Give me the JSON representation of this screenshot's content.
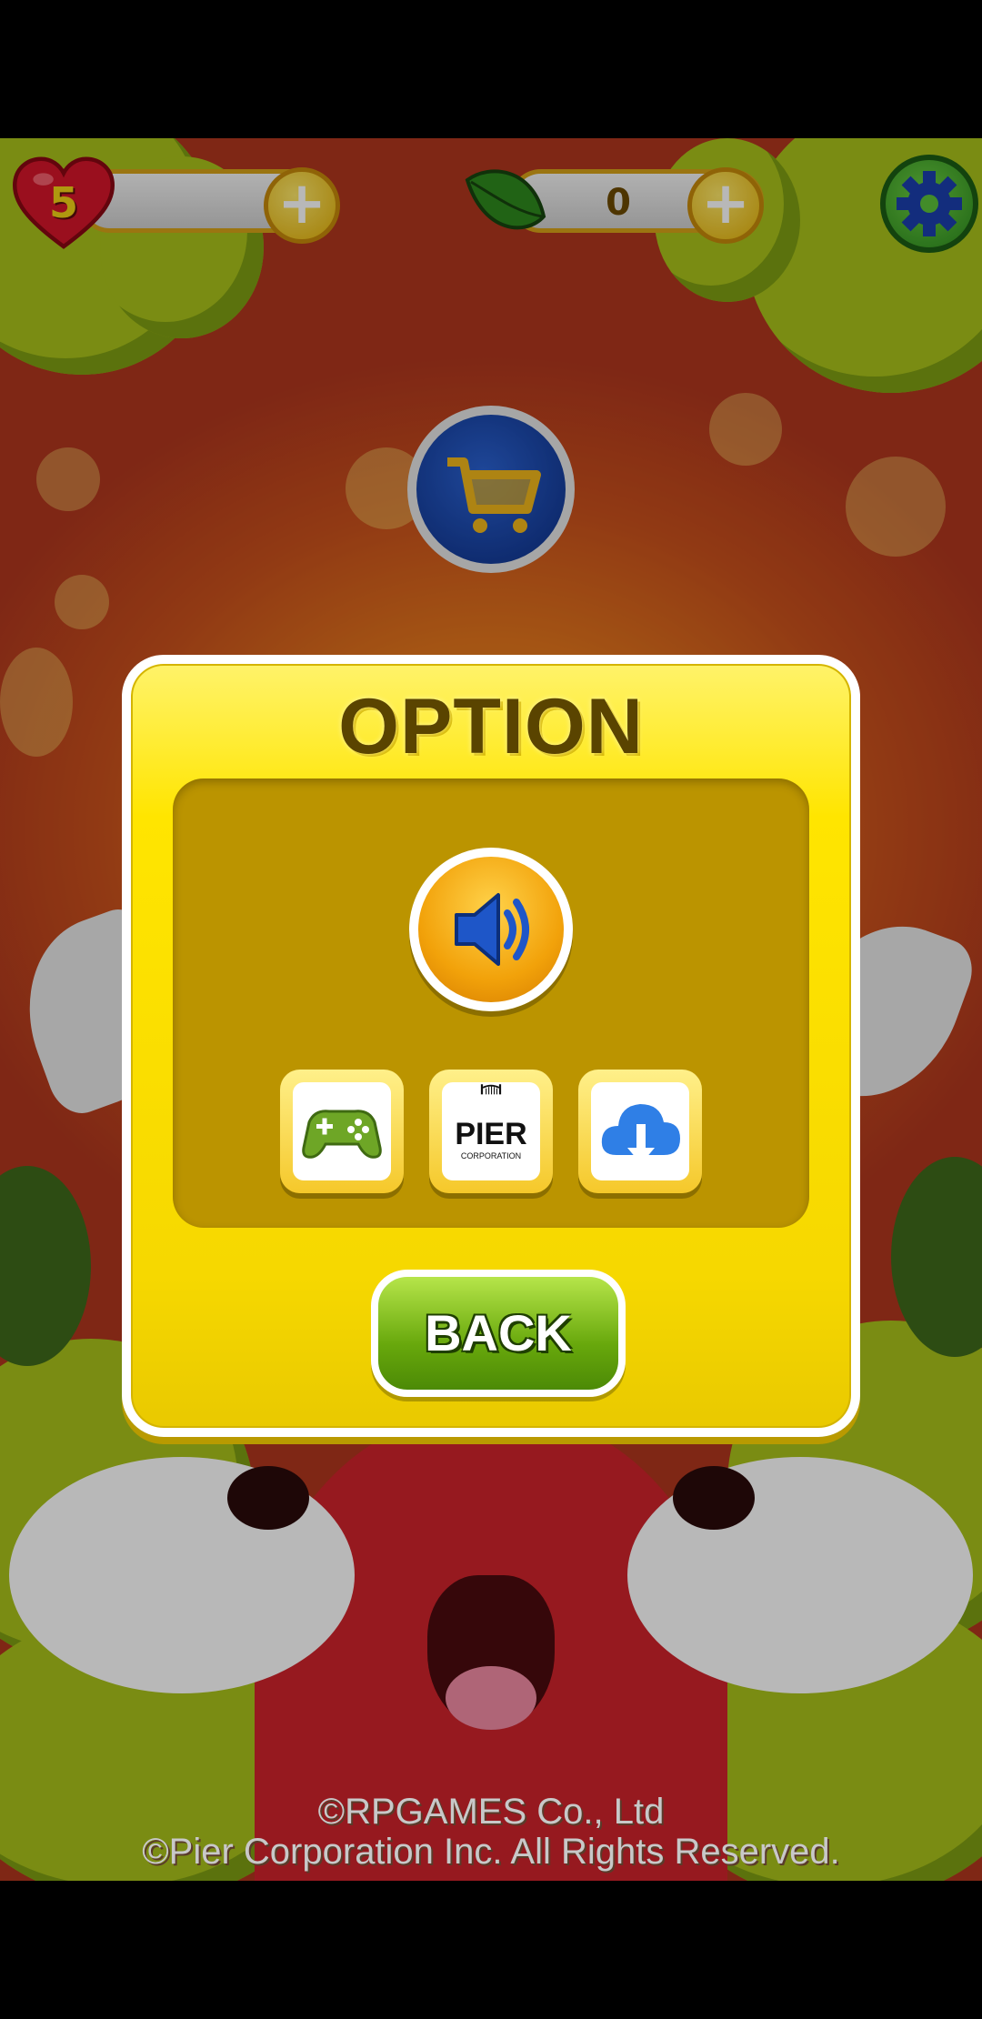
{
  "hud": {
    "lives": "5",
    "lives_icon": "heart-icon",
    "leaves": "0",
    "leaves_icon": "leaf-icon",
    "add_icon": "+",
    "settings_icon": "gear-icon",
    "shop_icon": "shopping-cart-icon"
  },
  "dialog": {
    "title": "OPTION",
    "sound_icon": "speaker-icon",
    "buttons": [
      {
        "icon": "gamepad-icon"
      },
      {
        "icon": "pier-corporation-logo",
        "logo_text": "PIER",
        "logo_sub": "CORPORATION"
      },
      {
        "icon": "cloud-download-icon"
      }
    ],
    "back_label": "BACK"
  },
  "footer": {
    "line1": "©RPGAMES Co., Ltd",
    "line2": "©Pier Corporation Inc. All Rights Reserved."
  },
  "colors": {
    "dialog_yellow": "#ffe500",
    "panel_brown": "#bb9400",
    "back_green": "#68a80c",
    "title_brown": "#5a4400"
  }
}
